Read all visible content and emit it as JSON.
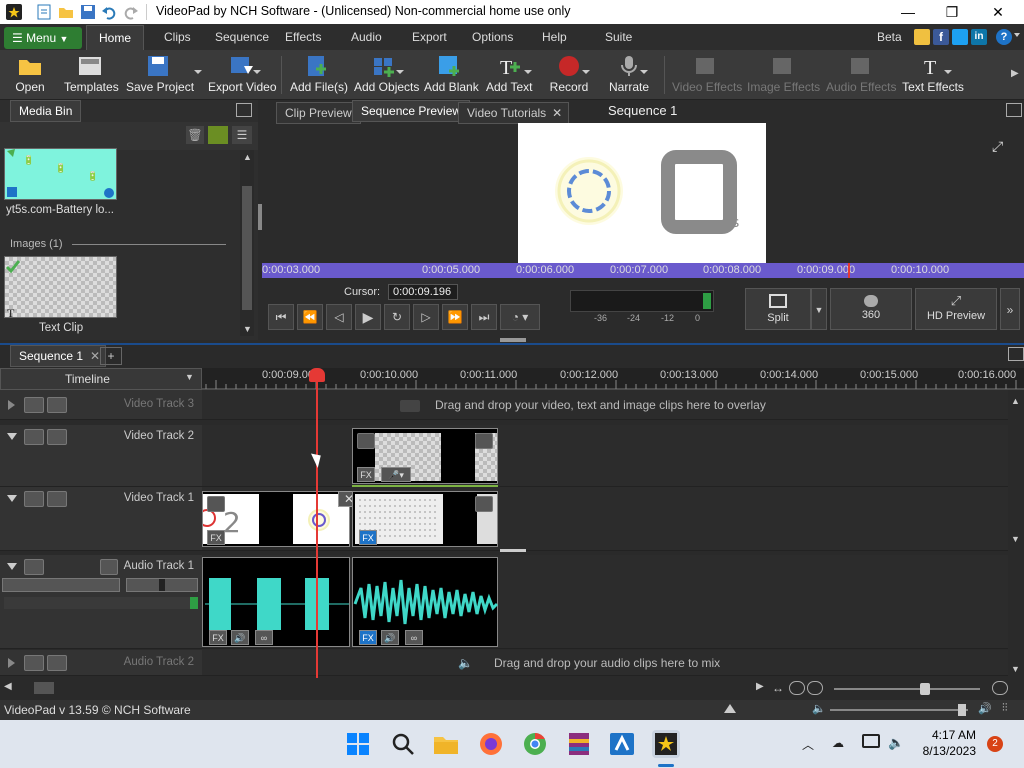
{
  "window": {
    "title": "VideoPad by NCH Software - (Unlicensed) Non-commercial home use only"
  },
  "menu": {
    "menu_label": "Menu",
    "tabs": [
      "Home",
      "Clips",
      "Sequence",
      "Effects",
      "Audio",
      "Export",
      "Options",
      "Help",
      "Suite"
    ],
    "beta_label": "Beta"
  },
  "toolbar": {
    "open": "Open",
    "templates": "Templates",
    "save_project": "Save Project",
    "export_video": "Export Video",
    "add_files": "Add File(s)",
    "add_objects": "Add Objects",
    "add_blank": "Add Blank",
    "add_text": "Add Text",
    "record": "Record",
    "narrate": "Narrate",
    "video_effects": "Video Effects",
    "image_effects": "Image Effects",
    "audio_effects": "Audio Effects",
    "text_effects": "Text Effects"
  },
  "media_bin": {
    "tab": "Media Bin",
    "clip1_name": "yt5s.com-Battery lo...",
    "images_header": "Images (1)",
    "clip2_name": "Text Clip"
  },
  "preview": {
    "tabs": [
      "Clip Preview",
      "Sequence Preview",
      "Video Tutorials"
    ],
    "sequence_title": "Sequence 1",
    "ruler_ticks": [
      "0:00:03.000",
      "0:00:05.000",
      "0:00:06.000",
      "0:00:07.000",
      "0:00:08.000",
      "0:00:09.000",
      "0:00:10.000"
    ],
    "cursor_label": "Cursor:",
    "cursor_value": "0:00:09.196",
    "meter_labels": [
      "-36",
      "-24",
      "-12",
      "0"
    ],
    "split_label": "Split",
    "btn_360": "360",
    "hd_preview": "HD Preview"
  },
  "timeline": {
    "sequence_tab": "Sequence 1",
    "label": "Timeline",
    "ruler_ticks": [
      "0:00:09.000",
      "0:00:10.000",
      "0:00:11.000",
      "0:00:12.000",
      "0:00:13.000",
      "0:00:14.000",
      "0:00:15.000",
      "0:00:16.000"
    ],
    "tracks": {
      "video3": "Video Track 3",
      "video2": "Video Track 2",
      "video1": "Video Track 1",
      "audio1": "Audio Track 1",
      "audio2": "Audio Track 2"
    },
    "overlay_hint": "Drag and drop your video, text and image clips here to overlay",
    "audio_hint": "Drag and drop your audio clips here to mix",
    "fx": "FX"
  },
  "status": {
    "version": "VideoPad v 13.59 © NCH Software"
  },
  "taskbar": {
    "time": "4:17 AM",
    "date": "8/13/2023",
    "notifications": "2"
  },
  "colors": {
    "accent_green": "#2e7d32",
    "purple_ruler": "#6a5acd",
    "waveform": "#3fd8c8",
    "playhead": "#e53935"
  }
}
